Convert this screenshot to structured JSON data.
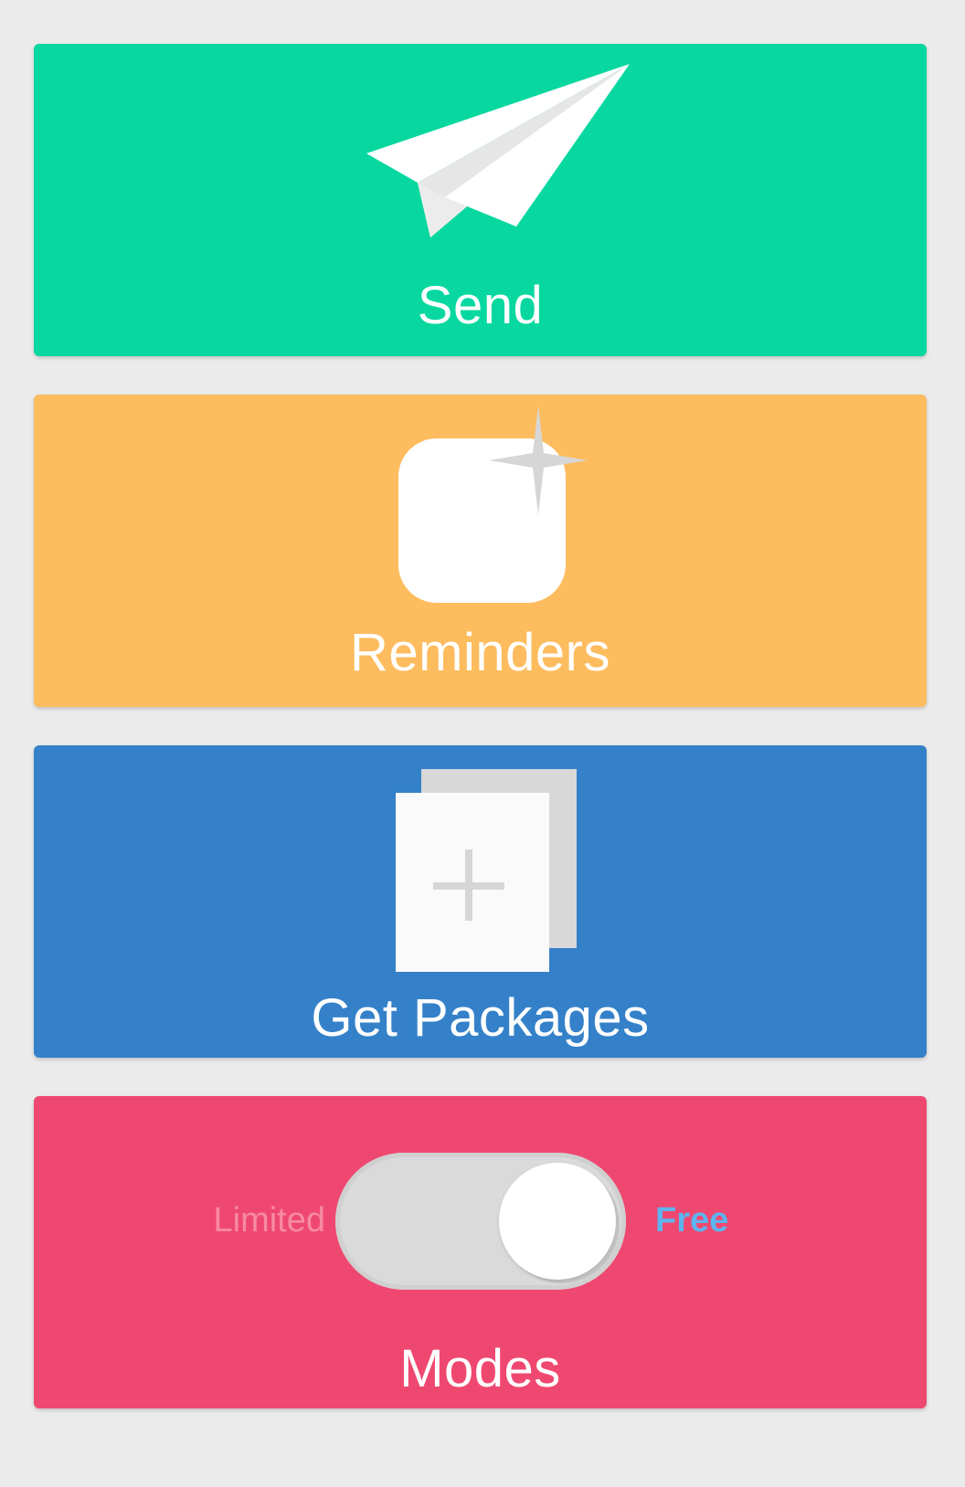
{
  "cards": [
    {
      "label": "Send",
      "color": "#08d8a0",
      "icon": "paper-plane-icon"
    },
    {
      "label": "Reminders",
      "color": "#fdbc5e",
      "icon": "reminder-sparkle-icon"
    },
    {
      "label": "Get Packages",
      "color": "#3481c9",
      "icon": "add-package-icon"
    },
    {
      "label": "Modes",
      "color": "#ef4870",
      "icon": "toggle-switch-icon"
    }
  ],
  "modes": {
    "left_label": "Limited",
    "right_label": "Free",
    "selected": "Free",
    "left_label_color": "#f78aa3",
    "right_label_color": "#5fb3ee"
  },
  "page_background": "#ebebeb"
}
